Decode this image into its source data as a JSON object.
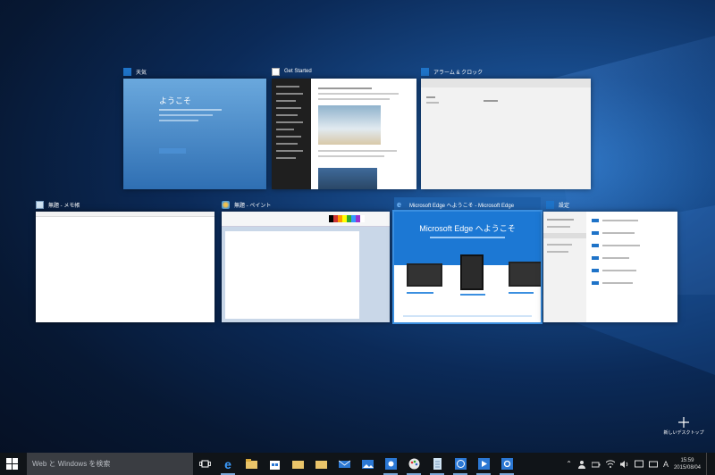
{
  "windows": [
    {
      "title": "天気",
      "icon": "weather-app-icon",
      "thumb_heading": "ようこそ"
    },
    {
      "title": "Get Started",
      "icon": "get-started-app-icon"
    },
    {
      "title": "アラーム & クロック",
      "icon": "alarms-clock-app-icon"
    },
    {
      "title": "無題 - メモ帳",
      "icon": "notepad-app-icon"
    },
    {
      "title": "無題 - ペイント",
      "icon": "paint-app-icon"
    },
    {
      "title": "Microsoft Edge へようこそ - Microsoft Edge",
      "icon": "edge-app-icon",
      "thumb_heading": "Microsoft Edge へようこそ"
    },
    {
      "title": "設定",
      "icon": "settings-app-icon"
    }
  ],
  "new_desktop": {
    "label": "新しいデスクトップ"
  },
  "taskbar": {
    "search_placeholder": "Web と Windows を検索",
    "pinned": [
      "task-view-icon",
      "edge-icon",
      "file-explorer-icon",
      "store-icon",
      "folder-icon",
      "folder-icon",
      "mail-icon",
      "photos-icon",
      "weather-icon",
      "paint-icon",
      "notepad-icon",
      "alarms-icon",
      "get-started-icon",
      "settings-icon"
    ],
    "clock_time": "15:59",
    "clock_date": "2015/08/04",
    "ime": "A"
  },
  "colors": {
    "accent": "#3b8fe0",
    "taskbar": "#101418",
    "search": "#3a3d42"
  }
}
